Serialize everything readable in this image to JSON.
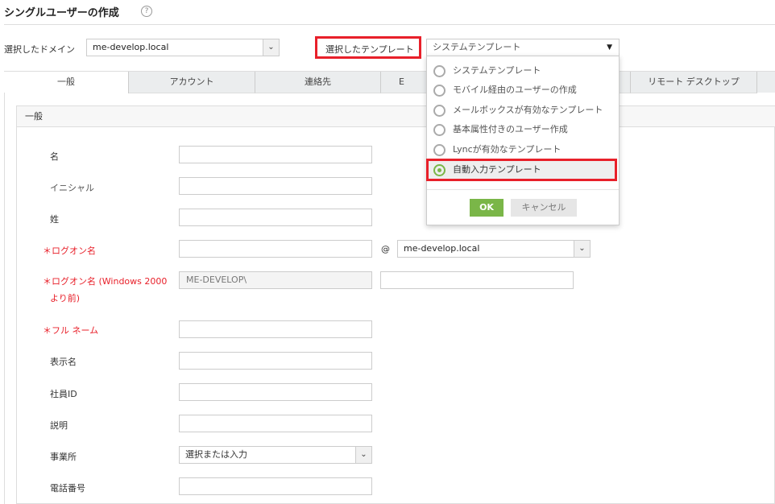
{
  "header": {
    "title": "シングルユーザーの作成",
    "help_icon": "?"
  },
  "domain": {
    "label": "選択したドメイン",
    "value": "me-develop.local"
  },
  "template": {
    "label": "選択したテンプレート",
    "value": "システムテンプレート"
  },
  "tabs": [
    "一般",
    "アカウント",
    "連絡先",
    "E",
    "リモート デスクトップ"
  ],
  "section_title": "一般",
  "fields": {
    "first_name": "名",
    "initials": "イニシャル",
    "last_name": "姓",
    "logon_name": "＊ログオン名",
    "at": "@",
    "logon_domain": "me-develop.local",
    "logon_pre2000_line1": "＊ログオン名 (Windows 2000",
    "logon_pre2000_line2": "より前)",
    "logon_pre2000_prefix": "ME-DEVELOP\\",
    "full_name": "＊フル ネーム",
    "display_name": "表示名",
    "employee_id": "社員ID",
    "description": "説明",
    "office": "事業所",
    "office_placeholder": "選択または入力",
    "phone": "電話番号"
  },
  "dropdown": {
    "options": [
      "システムテンプレート",
      "モバイル経由のユーザーの作成",
      "メールボックスが有効なテンプレート",
      "基本属性付きのユーザー作成",
      "Lyncが有効なテンプレート",
      "自動入力テンプレート"
    ],
    "selected_index": 5,
    "ok": "OK",
    "cancel": "キャンセル"
  },
  "colors": {
    "accent": "#7ab648",
    "highlight": "#e8202a",
    "required": "#e8202a"
  }
}
